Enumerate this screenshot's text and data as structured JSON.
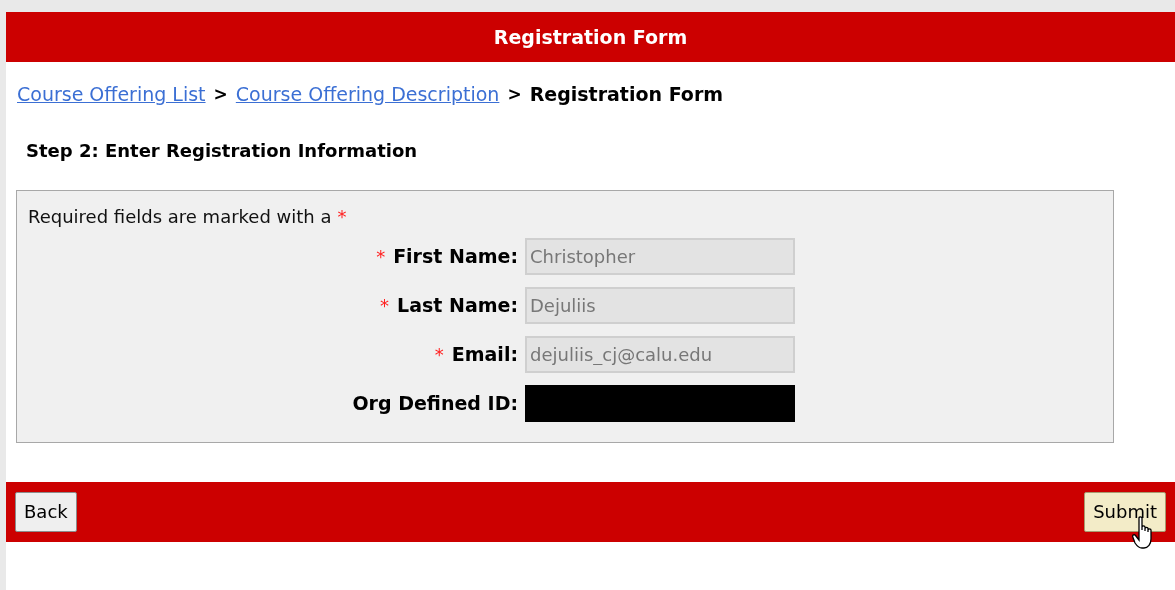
{
  "header": {
    "title": "Registration Form"
  },
  "breadcrumb": [
    {
      "label": "Course Offering List",
      "kind": "link"
    },
    {
      "label": "Course Offering Description",
      "kind": "link"
    },
    {
      "label": "Registration Form",
      "kind": "current"
    }
  ],
  "separator": ">",
  "step_heading": "Step 2: Enter Registration Information",
  "required_note": {
    "text": "Required fields are marked with a",
    "marker": "*"
  },
  "fields": [
    {
      "label": "First Name:",
      "required": true,
      "kind": "text",
      "value": "Christopher",
      "disabled": true
    },
    {
      "label": "Last Name:",
      "required": true,
      "kind": "text",
      "value": "Dejuliis",
      "disabled": true
    },
    {
      "label": "Email:",
      "required": true,
      "kind": "text",
      "value": "dejuliis_cj@calu.edu",
      "disabled": true
    },
    {
      "label": "Org Defined ID:",
      "required": false,
      "kind": "redacted"
    }
  ],
  "buttons": [
    {
      "label": "Back",
      "hovered": false
    },
    {
      "label": "Submit",
      "hovered": true
    }
  ]
}
